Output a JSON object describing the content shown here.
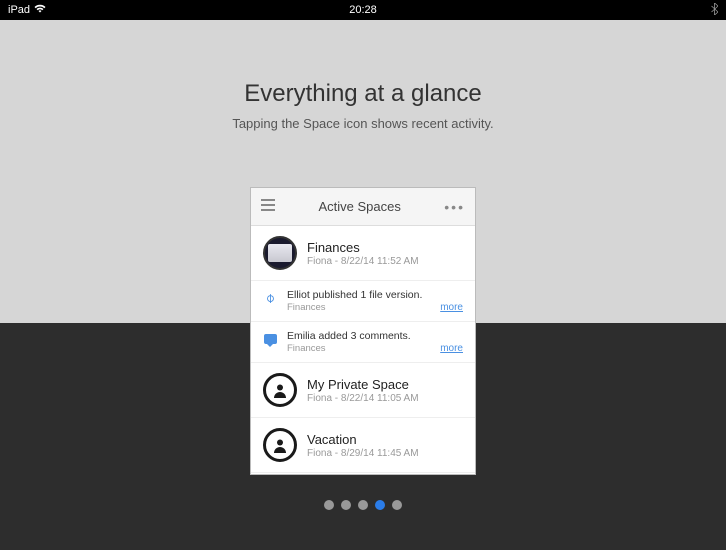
{
  "status": {
    "device": "iPad",
    "time": "20:28"
  },
  "hero": {
    "title": "Everything at a glance",
    "subtitle": "Tapping the Space icon shows recent activity."
  },
  "mock": {
    "header_title": "Active Spaces",
    "spaces": [
      {
        "name": "Finances",
        "meta": "Fiona - 8/22/14 11:52 AM"
      },
      {
        "name": "My Private Space",
        "meta": "Fiona - 8/22/14 11:05 AM"
      },
      {
        "name": "Vacation",
        "meta": "Fiona - 8/29/14 11:45 AM"
      }
    ],
    "activities": [
      {
        "text": "Elliot published 1 file version.",
        "sub": "Finances",
        "more": "more"
      },
      {
        "text": "Emilia added 3 comments.",
        "sub": "Finances",
        "more": "more"
      }
    ]
  },
  "pagination": {
    "total": 5,
    "active_index": 3
  }
}
